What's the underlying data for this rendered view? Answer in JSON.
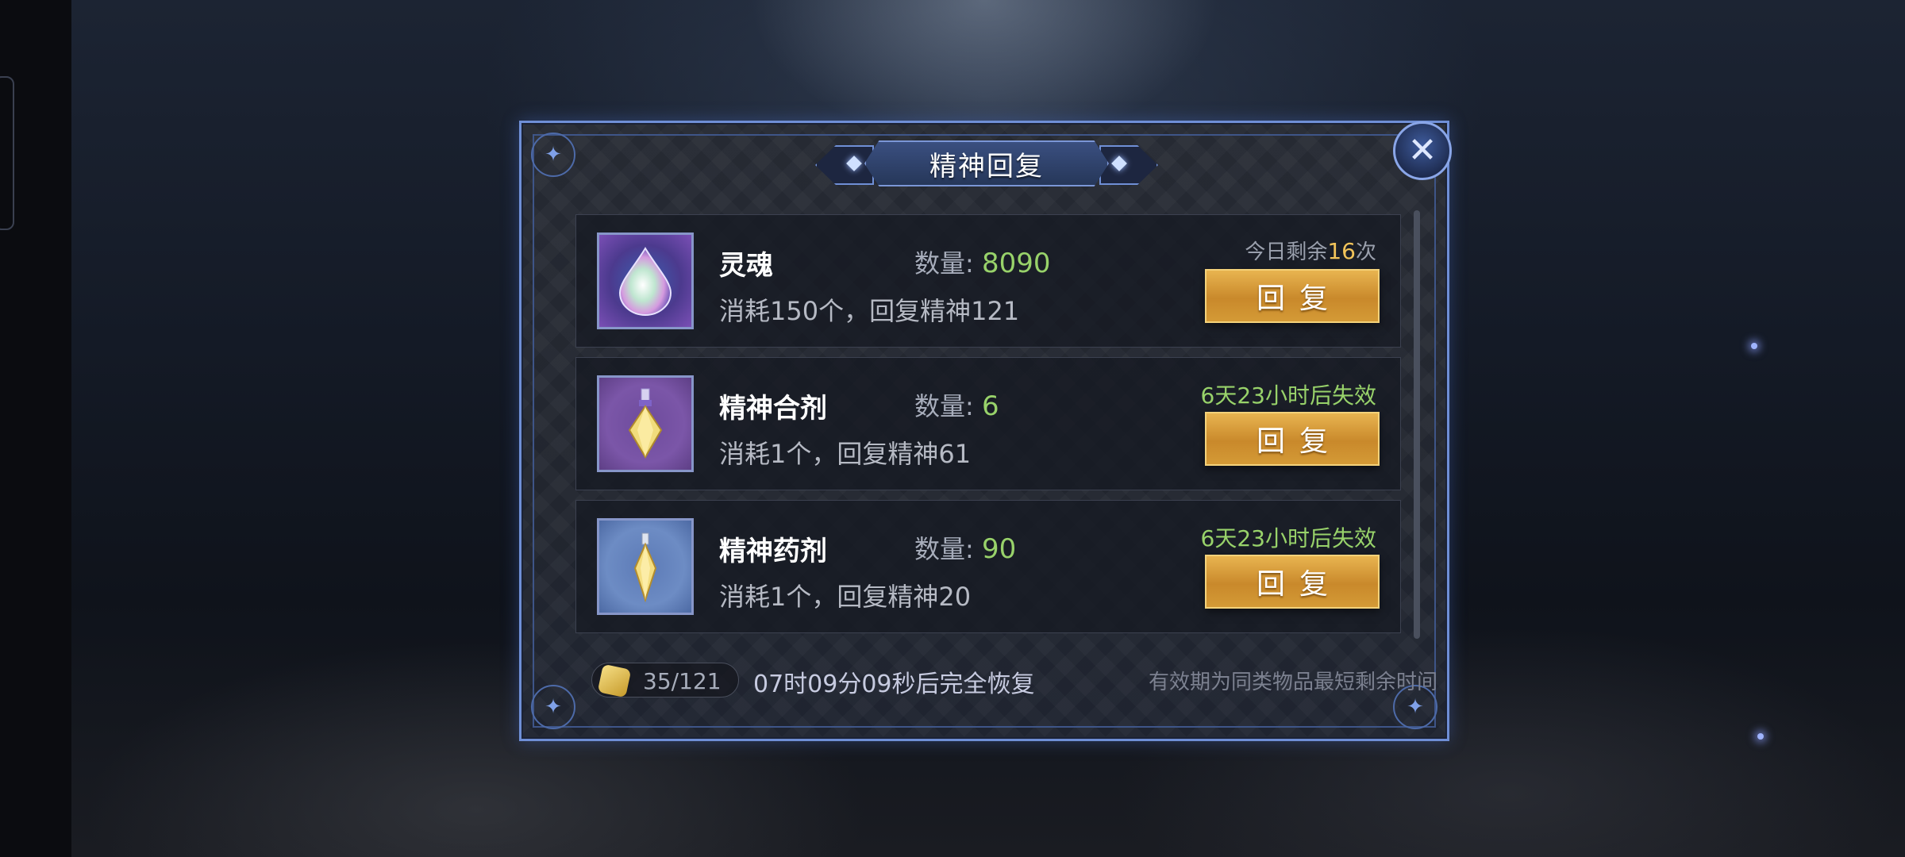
{
  "dialog": {
    "title": "精神回复",
    "close_icon": "close-icon",
    "items": [
      {
        "name": "灵魂",
        "qty_label": "数量:",
        "qty_value": "8090",
        "desc": "消耗150个，回复精神121",
        "note_prefix": "今日剩余",
        "note_count": "16",
        "note_suffix": "次",
        "button": "回复",
        "icon": "soul-crystal-icon"
      },
      {
        "name": "精神合剂",
        "qty_label": "数量:",
        "qty_value": "6",
        "desc": "消耗1个，回复精神61",
        "note": "6天23小时后失效",
        "button": "回复",
        "icon": "spirit-mixture-icon"
      },
      {
        "name": "精神药剂",
        "qty_label": "数量:",
        "qty_value": "90",
        "desc": "消耗1个，回复精神20",
        "note": "6天23小时后失效",
        "button": "回复",
        "icon": "spirit-potion-icon"
      }
    ],
    "footer": {
      "stamina": "35/121",
      "recover_time": "07时09分09秒后完全恢复",
      "hint": "有效期为同类物品最短剩余时间"
    }
  },
  "colors": {
    "frame": "#6f8fd6",
    "quantity": "#98d26a",
    "count_highlight": "#f2c45a",
    "button": "#d49a36"
  }
}
